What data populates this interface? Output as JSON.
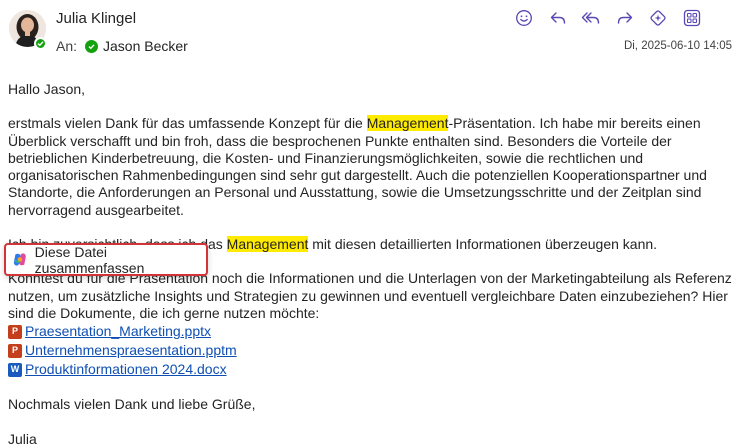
{
  "header": {
    "sender_name": "Julia Klingel",
    "to_label": "An:",
    "recipient": "Jason Becker",
    "date": "Di, 2025-06-10 14:05"
  },
  "toolbar": {
    "icons": [
      "emoji-icon",
      "reply-icon",
      "reply-all-icon",
      "forward-icon",
      "copilot-sparkle-icon",
      "apps-icon"
    ]
  },
  "email": {
    "greeting": "Hallo Jason,",
    "p1_before": "erstmals vielen Dank für das umfassende Konzept für die ",
    "p1_highlight": "Management",
    "p1_after": "-Präsentation. Ich habe mir bereits einen Überblick verschafft und bin froh, dass die besprochenen Punkte enthalten sind. Besonders die Vorteile der betrieblichen Kinderbetreuung, die Kosten- und Finanzierungsmöglichkeiten, sowie die rechtlichen und organisatorischen Rahmenbedingungen sind sehr gut dargestellt. Auch die potenziellen Kooperationspartner und Standorte, die Anforderungen an Personal und Ausstattung, sowie die Umsetzungsschritte und der Zeitplan sind hervorragend ausgearbeitet.",
    "p2_before": "Ich bin zuversichtlich, dass ich das ",
    "p2_highlight": "Management",
    "p2_after": " mit diesen detaillierten Informationen überzeugen kann.",
    "p3": "Könntest du für die Präsentation noch die Informationen und die Unterlagen von der Marketingabteilung als Referenz nutzen, um zusätzliche Insights und Strategien zu gewinnen und eventuell vergleichbare Daten einzubeziehen? Hier sind die Dokumente, die ich gerne nutzen möchte:",
    "attachments": [
      {
        "name": "Praesentation_Marketing.pptx",
        "type": "powerpoint"
      },
      {
        "name": "Unternehmenspraesentation.pptm",
        "type": "powerpoint"
      },
      {
        "name": "Produktinformationen 2024.docx",
        "type": "word"
      }
    ],
    "closing": "Nochmals vielen Dank und liebe Grüße,",
    "signature": "Julia"
  },
  "popup": {
    "label": "Diese Datei zusammenfassen"
  },
  "colors": {
    "accent": "#5b47b3",
    "highlight": "#ffeb00",
    "link": "#0f4fb3",
    "focus_border": "#d13438",
    "presence": "#13a10e"
  }
}
